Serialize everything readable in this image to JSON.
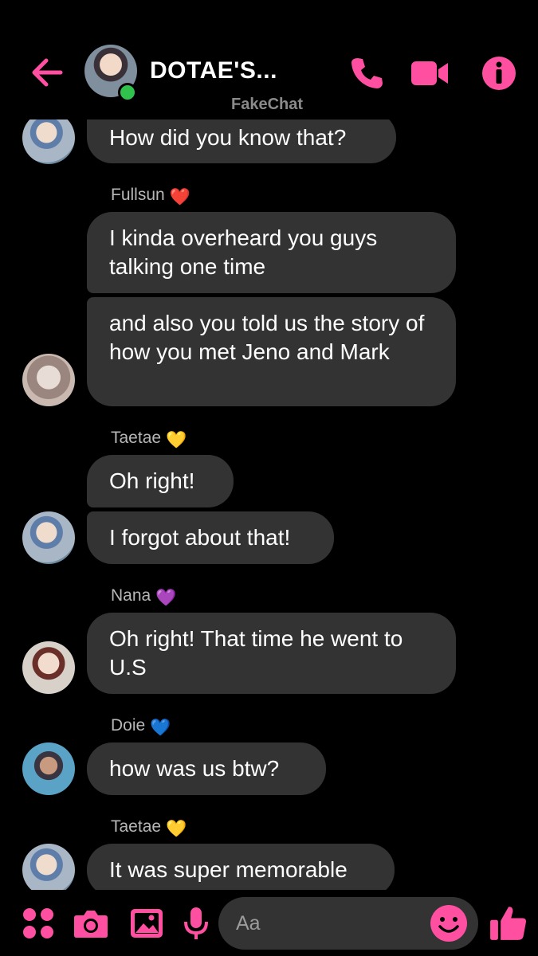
{
  "header": {
    "title": "DOTAE'S...",
    "watermark": "FakeChat"
  },
  "composer": {
    "placeholder": "Aa"
  },
  "colors": {
    "accent": "#ff4fa1",
    "bubble": "#333333",
    "online": "#31c24d"
  },
  "icons": {
    "back": "back-arrow-icon",
    "call": "phone-icon",
    "video": "video-camera-icon",
    "info": "info-icon",
    "menu": "four-dots-icon",
    "camera": "camera-icon",
    "gallery": "image-icon",
    "mic": "microphone-icon",
    "emoji": "smiley-icon",
    "like": "thumbs-up-icon"
  },
  "messages": [
    {
      "text": "How did you know that?"
    },
    {
      "sender": "Fullsun",
      "heart": "❤️"
    },
    {
      "text": "I kinda overheard you guys talking one time"
    },
    {
      "text": "and also you told us the story of how you met Jeno and Mark"
    },
    {
      "sender": "Taetae",
      "heart": "💛"
    },
    {
      "text": "Oh right!"
    },
    {
      "text": "I forgot about that!"
    },
    {
      "sender": "Nana",
      "heart": "💜"
    },
    {
      "text": "Oh right! That time he went to U.S"
    },
    {
      "sender": "Doie",
      "heart": "💙"
    },
    {
      "text": "how was us btw?"
    },
    {
      "sender": "Taetae",
      "heart": "💛"
    },
    {
      "text": "It was super memorable"
    }
  ]
}
